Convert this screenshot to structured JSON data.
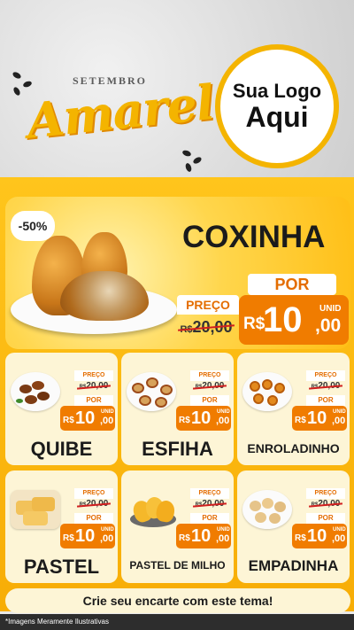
{
  "header": {
    "subtitle": "SETEMBRO",
    "title": "Amarelo",
    "logo_line1": "Sua Logo",
    "logo_line2": "Aqui"
  },
  "hero": {
    "discount": "-50%",
    "name": "COXINHA",
    "preco_label": "PREÇO",
    "old_currency": "R$",
    "old_amount": "20,00",
    "por_label": "POR",
    "new_currency": "R$",
    "new_value": "10",
    "new_cents": ",00",
    "unit": "UNID"
  },
  "products": [
    {
      "name": "QUIBE",
      "preco_label": "PREÇO",
      "old_currency": "R$",
      "old_amount": "20,00",
      "por_label": "POR",
      "currency": "R$",
      "value": "10",
      "cents": ",00",
      "unit": "UNID"
    },
    {
      "name": "ESFIHA",
      "preco_label": "PREÇO",
      "old_currency": "R$",
      "old_amount": "20,00",
      "por_label": "POR",
      "currency": "R$",
      "value": "10",
      "cents": ",00",
      "unit": "UNID"
    },
    {
      "name": "ENROLADINHO",
      "preco_label": "PREÇO",
      "old_currency": "R$",
      "old_amount": "20,00",
      "por_label": "POR",
      "currency": "R$",
      "value": "10",
      "cents": ",00",
      "unit": "UNID"
    },
    {
      "name": "PASTEL",
      "preco_label": "PREÇO",
      "old_currency": "R$",
      "old_amount": "20,00",
      "por_label": "POR",
      "currency": "R$",
      "value": "10",
      "cents": ",00",
      "unit": "UNID"
    },
    {
      "name": "PASTEL DE MILHO",
      "preco_label": "PREÇO",
      "old_currency": "R$",
      "old_amount": "20,00",
      "por_label": "POR",
      "currency": "R$",
      "value": "10",
      "cents": ",00",
      "unit": "UNID"
    },
    {
      "name": "EMPADINHA",
      "preco_label": "PREÇO",
      "old_currency": "R$",
      "old_amount": "20,00",
      "por_label": "POR",
      "currency": "R$",
      "value": "10",
      "cents": ",00",
      "unit": "UNID"
    }
  ],
  "cta": "Crie seu encarte com este tema!",
  "footer": "*Imagens Meramente Ilustrativas",
  "colors": {
    "accent_yellow": "#f4b400",
    "price_orange": "#f07c00",
    "card_bg": "#fdf5d6",
    "strike_red": "#d01e1e"
  }
}
